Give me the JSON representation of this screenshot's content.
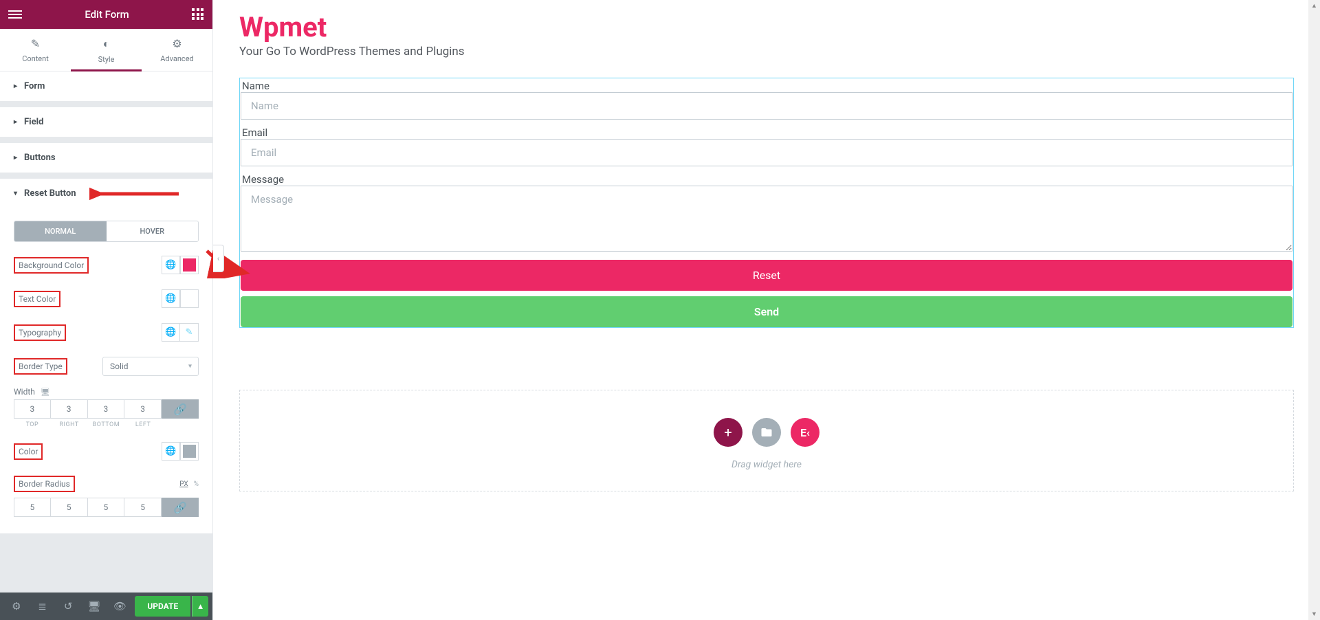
{
  "header": {
    "title": "Edit Form"
  },
  "tabs": {
    "content": "Content",
    "style": "Style",
    "advanced": "Advanced"
  },
  "accordions": {
    "form": "Form",
    "field": "Field",
    "buttons": "Buttons",
    "reset": "Reset Button"
  },
  "segments": {
    "normal": "NORMAL",
    "hover": "HOVER"
  },
  "controls": {
    "bg_color_label": "Background Color",
    "text_color_label": "Text Color",
    "typography_label": "Typography",
    "border_type_label": "Border Type",
    "border_type_value": "Solid",
    "width_label": "Width",
    "width_values": {
      "top": "3",
      "right": "3",
      "bottom": "3",
      "left": "3"
    },
    "width_sides": {
      "top": "TOP",
      "right": "RIGHT",
      "bottom": "BOTTOM",
      "left": "LEFT"
    },
    "color_label": "Color",
    "border_radius_label": "Border Radius",
    "border_radius_values": {
      "tl": "5",
      "tr": "5",
      "br": "5",
      "bl": "5"
    },
    "units": {
      "px": "PX",
      "pct": "%"
    },
    "colors": {
      "pink": "#ec2865",
      "gray": "#a4afb7"
    }
  },
  "footer": {
    "update": "UPDATE"
  },
  "preview": {
    "brand": "Wpmet",
    "tagline": "Your Go To WordPress Themes and Plugins",
    "name_label": "Name",
    "name_placeholder": "Name",
    "email_label": "Email",
    "email_placeholder": "Email",
    "message_label": "Message",
    "message_placeholder": "Message",
    "reset_btn": "Reset",
    "send_btn": "Send",
    "drop_text": "Drag widget here"
  }
}
